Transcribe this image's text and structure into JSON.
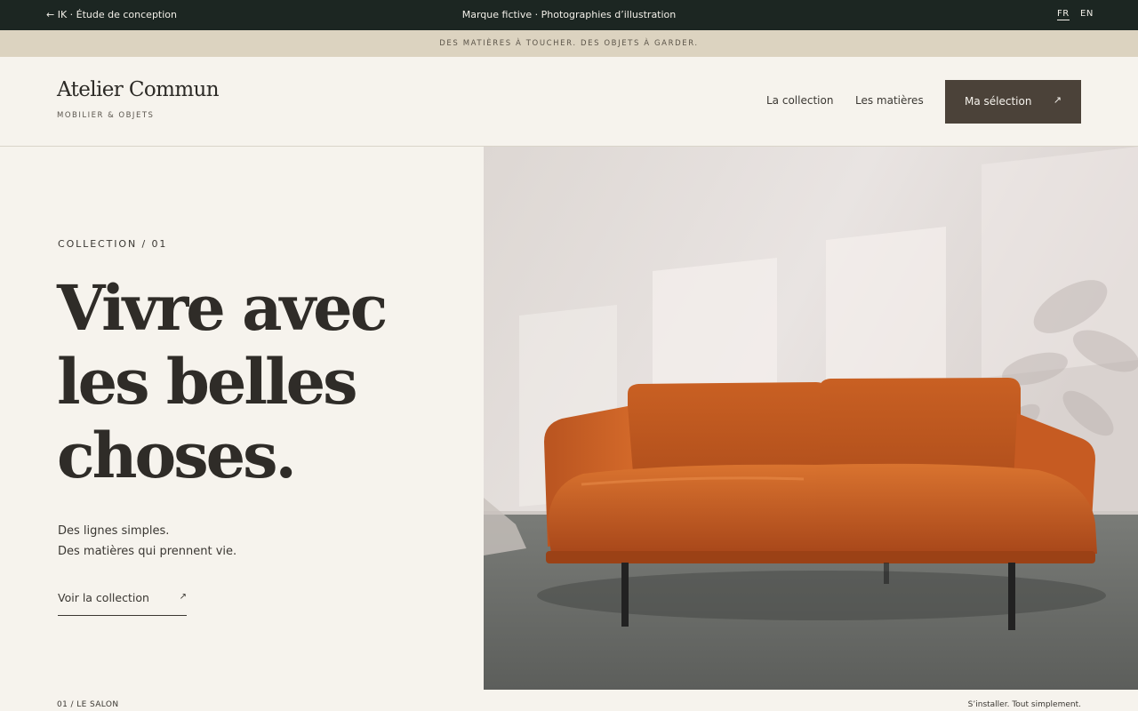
{
  "topbar": {
    "back_label": "← IK · Étude de conception",
    "center_text": "Marque fictive · Photographies d’illustration",
    "lang_fr": "FR",
    "lang_en": "EN"
  },
  "announcement": "DES MATIÈRES À TOUCHER. DES OBJETS À GARDER.",
  "header": {
    "brand": "Atelier Commun",
    "tagline": "MOBILIER & OBJETS",
    "nav": [
      "La collection",
      "Les matières"
    ],
    "cta_label": "Ma sélection",
    "cta_icon": "↗"
  },
  "hero": {
    "kicker": "COLLECTION / 01",
    "headline": [
      "Vivre avec",
      "les belles",
      "choses."
    ],
    "subtitle": [
      "Des lignes simples.",
      "Des matières qui prennent vie."
    ],
    "link_label": "Voir la collection",
    "link_icon": "↗",
    "image": "cognac-leather-sofa-photo"
  },
  "footer": {
    "left": "01 / LE SALON",
    "right": "S’installer. Tout simplement."
  },
  "colors": {
    "topbar": "#1c2622",
    "announcement": "#dcd3c0",
    "page": "#f6f3ed",
    "cta": "#4b4239",
    "sofa": "#c35a1f"
  }
}
